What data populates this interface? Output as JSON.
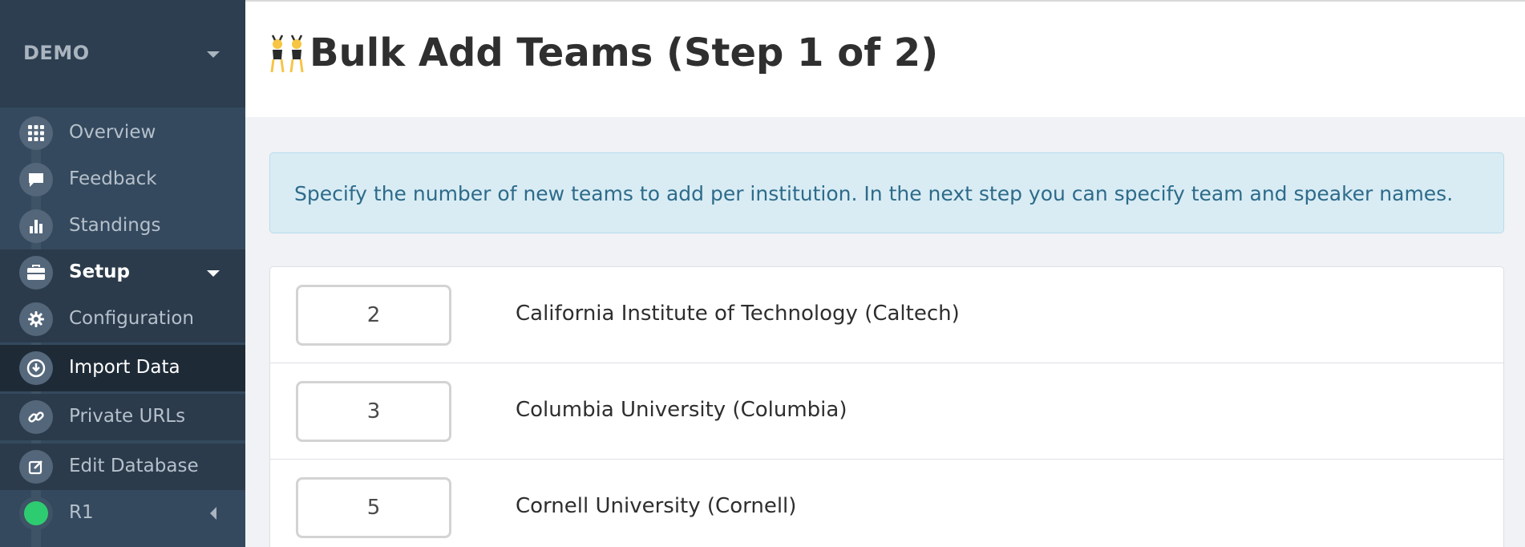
{
  "sidebar": {
    "brand": "DEMO",
    "items": [
      {
        "label": "Overview",
        "icon": "grid-icon"
      },
      {
        "label": "Feedback",
        "icon": "chat-bubble-icon"
      },
      {
        "label": "Standings",
        "icon": "bar-chart-icon"
      },
      {
        "label": "Setup",
        "icon": "briefcase-icon"
      },
      {
        "label": "Configuration",
        "icon": "gear-icon"
      },
      {
        "label": "Import Data",
        "icon": "download-circle-icon"
      },
      {
        "label": "Private URLs",
        "icon": "link-icon"
      },
      {
        "label": "Edit Database",
        "icon": "edit-icon"
      },
      {
        "label": "R1",
        "icon": "status-dot-icon"
      }
    ]
  },
  "header": {
    "title": "Bulk Add Teams (Step 1 of 2)",
    "title_emoji": "dancers-emoji"
  },
  "alert": {
    "text": "Specify the number of new teams to add per institution. In the next step you can specify team and speaker names."
  },
  "institutions": [
    {
      "count": "2",
      "name": "California Institute of Technology (Caltech)"
    },
    {
      "count": "3",
      "name": "Columbia University (Columbia)"
    },
    {
      "count": "5",
      "name": "Cornell University (Cornell)"
    }
  ],
  "colors": {
    "sidebar_bg": "#34495e",
    "sidebar_active": "#1e2b37",
    "alert_bg": "#d9ecf4",
    "alert_text": "#2d6b8a",
    "round_status": "#2ecc71"
  }
}
